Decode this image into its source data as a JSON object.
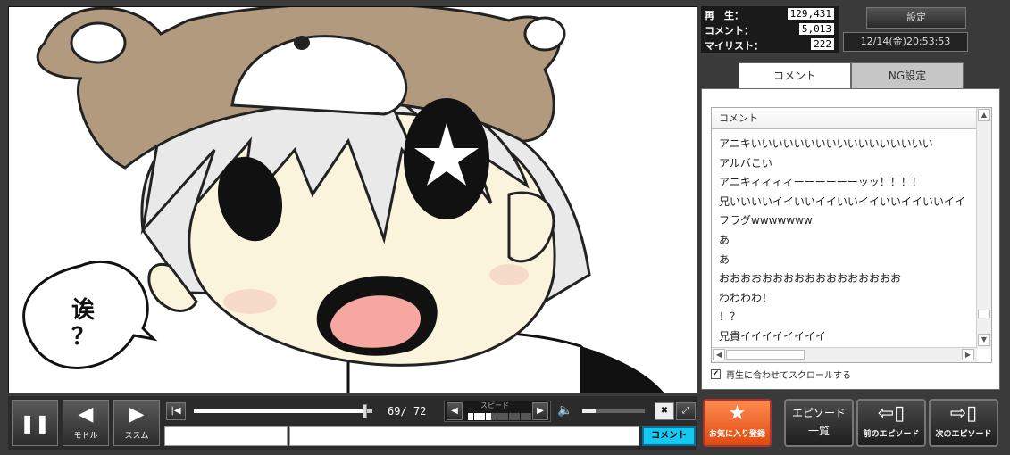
{
  "video": {
    "speech_bubble_text": [
      "诶",
      "？"
    ]
  },
  "stats": {
    "views_label": "再　生：",
    "views": "129,431",
    "comments_label": "コメント：",
    "comments": "5,013",
    "mylist_label": "マイリスト：",
    "mylist": "222"
  },
  "header": {
    "settings_label": "設定",
    "datetime": "12/14(金)20:53:53"
  },
  "tabs": [
    {
      "label": "コメント"
    },
    {
      "label": "NG設定"
    }
  ],
  "comment_panel": {
    "header": "コメント",
    "rows": [
      "アニキいいいいいいいいいいいいいいいいい",
      "アルバこい",
      "アニキィィィィーーーーーーッッ！！！！",
      "兄いいいいイイいいイイいいイイいいイイいいイイ",
      "フラグwwwwwww",
      "あ",
      "あ",
      "おおおおおおおおおおおおおおおおお",
      "わわわわ！",
      "！？",
      "兄貴イイイイイイイイ"
    ],
    "scroll_option_label": "再生に合わせてスクロールする",
    "scroll_option_checked": "✔"
  },
  "controls": {
    "pause_glyph": "❚❚",
    "back_glyph": "◀",
    "back_label": "モドル",
    "forward_glyph": "▶",
    "forward_label": "ススム",
    "time_current": "69",
    "time_total": "72",
    "time_sep": "/",
    "playback_progress": 0.958,
    "speed_label": "スピード",
    "speed_level": 4,
    "speed_max": 11,
    "volume_level": 0.22,
    "comment_send_label": "コメント"
  },
  "side_buttons": {
    "favorite_label": "お気に入り登録",
    "episode_list_label_1": "エピソード",
    "episode_list_label_2": "一覧",
    "prev_episode_label": "前のエピソード",
    "next_episode_label": "次のエピソード"
  },
  "colors": {
    "accent_comment_button": "#14c8f0",
    "favorite_button": "#e85a20"
  }
}
